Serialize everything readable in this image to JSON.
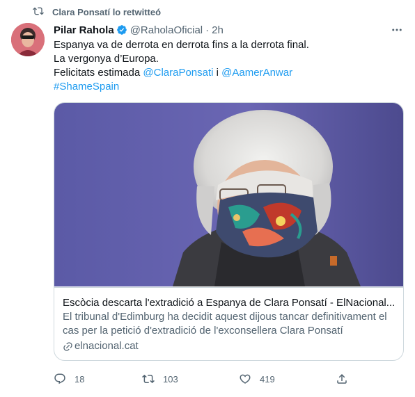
{
  "retweet": {
    "label": "Clara Ponsatí lo retwitteó",
    "icon": "retweet-icon"
  },
  "tweet": {
    "author_name": "Pilar Rahola",
    "author_handle": "@RaholaOficial",
    "separator": "·",
    "time": "2h",
    "verified_icon": "verified-badge-icon",
    "more_icon": "more-options-icon",
    "text_line1": "Espanya va de derrota en derrota fins a la derrota final.",
    "text_line2": "La vergonya d’Europa.",
    "text_line3_prefix": "Felicitats estimada ",
    "mention1": "@ClaraPonsati",
    "text_line3_mid": " i ",
    "mention2": "@AamerAnwar",
    "hashtag": "#ShameSpain"
  },
  "card": {
    "title": "Escòcia descarta l'extradició a Espanya de Clara Ponsatí - ElNacional....",
    "description": "El tribunal d'Edimburg ha decidit aquest dijous tancar definitivament el cas per la petició d'extradició de l'exconsellera Clara Ponsatí",
    "domain": "elnacional.cat",
    "link_icon": "link-icon"
  },
  "actions": {
    "reply_count": "18",
    "retweet_count": "103",
    "like_count": "419",
    "reply_icon": "reply-icon",
    "retweet_icon": "retweet-icon",
    "like_icon": "heart-icon",
    "share_icon": "share-icon"
  },
  "colors": {
    "link": "#1d9bf0",
    "secondary_text": "#536471",
    "border": "#cfd9de",
    "text": "#0f1419"
  }
}
